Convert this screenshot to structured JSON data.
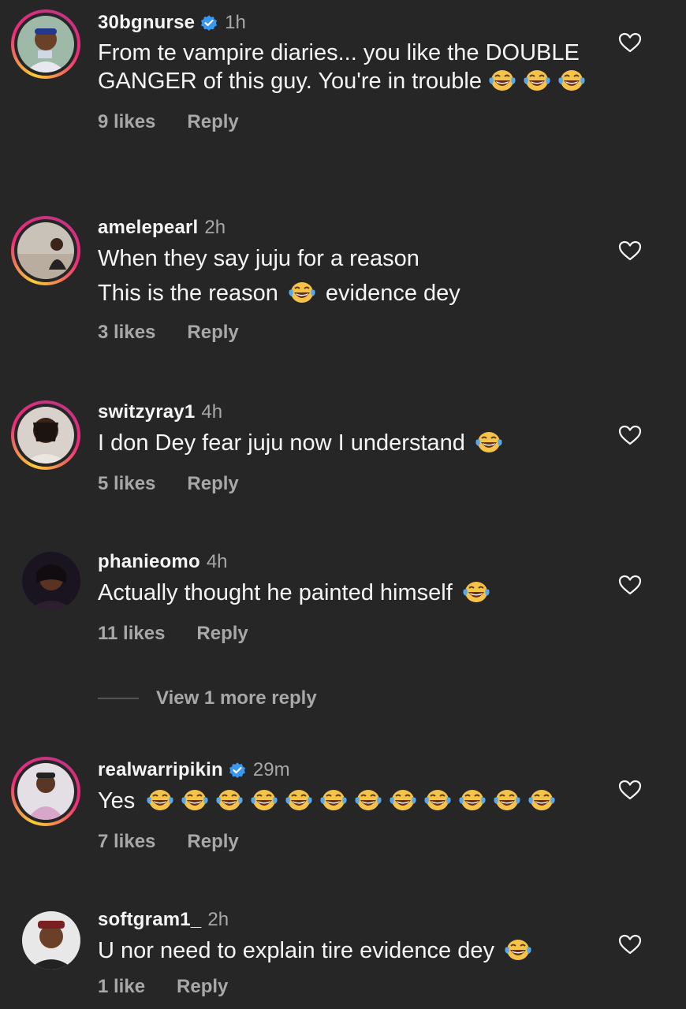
{
  "comments": [
    {
      "username": "30bgnurse",
      "verified": true,
      "time": "1h",
      "text": "From te vampire diaries... you like the DOUBLE GANGER of this guy. You're in trouble",
      "emoji_count": 3,
      "likes": "9 likes",
      "reply": "Reply"
    },
    {
      "username": "amelepearl",
      "verified": false,
      "time": "2h",
      "text_line1": "When they say juju for a reason",
      "text_line2a": "This is the reason",
      "text_line2b": "evidence dey",
      "likes": "3 likes",
      "reply": "Reply"
    },
    {
      "username": "switzyray1",
      "verified": false,
      "time": "4h",
      "text": "I don Dey fear juju now I understand",
      "likes": "5 likes",
      "reply": "Reply"
    },
    {
      "username": "phanieomo",
      "verified": false,
      "time": "4h",
      "text": "Actually thought he painted himself",
      "likes": "11 likes",
      "reply": "Reply"
    },
    {
      "username": "realwarripikin",
      "verified": true,
      "time": "29m",
      "text": "Yes",
      "emoji_count": 12,
      "likes": "7 likes",
      "reply": "Reply"
    },
    {
      "username": "softgram1_",
      "verified": false,
      "time": "2h",
      "text": "U nor need to explain tire evidence dey",
      "likes": "1 like",
      "reply": "Reply"
    }
  ],
  "view_more": "View 1 more reply",
  "icons": {
    "like": "heart-outline-icon",
    "verified": "verified-badge-icon",
    "emoji": "face-with-tears-of-joy-emoji"
  },
  "colors": {
    "background": "#262626",
    "text": "#f5f5f5",
    "muted": "#a8a8a8",
    "verified": "#3897f0"
  }
}
